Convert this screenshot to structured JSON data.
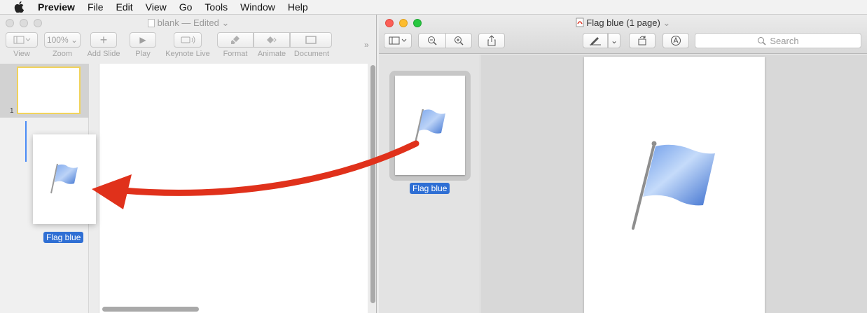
{
  "menubar": {
    "app": "Preview",
    "items": [
      "File",
      "Edit",
      "View",
      "Go",
      "Tools",
      "Window",
      "Help"
    ]
  },
  "keynote": {
    "title": "blank",
    "title_suffix": "— Edited",
    "zoom": "100%",
    "toolbar": [
      "View",
      "Zoom",
      "Add Slide",
      "Play",
      "Keynote Live",
      "Format",
      "Animate",
      "Document"
    ],
    "slide_number": "1"
  },
  "drag": {
    "label": "Flag blue"
  },
  "preview": {
    "title": "Flag blue (1 page)",
    "search_placeholder": "Search",
    "thumbnail_label": "Flag blue"
  },
  "colors": {
    "accent": "#2f6fd4",
    "arrow": "#e0311b",
    "flag": "#5b8ee0",
    "selection": "#f1d35b"
  },
  "icons": [
    "apple-icon",
    "sidebar-icon",
    "zoom-out-icon",
    "zoom-in-icon",
    "share-icon",
    "markup-pen-icon",
    "rotate-icon",
    "annotate-icon",
    "search-icon",
    "pdf-icon"
  ]
}
